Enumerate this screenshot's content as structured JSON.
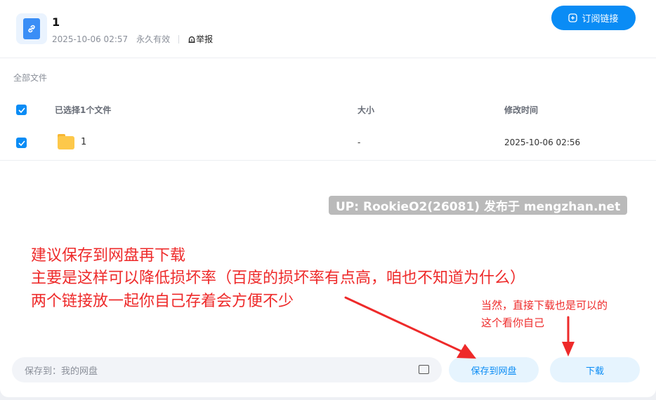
{
  "header": {
    "title": "1",
    "created": "2025-10-06 02:57",
    "validity": "永久有效",
    "report_label": "举报",
    "subscribe_label": "订阅链接"
  },
  "breadcrumb": "全部文件",
  "table": {
    "headers": [
      "已选择1个文件",
      "大小",
      "修改时间"
    ],
    "rows": [
      {
        "name": "1",
        "size": "-",
        "modified": "2025-10-06 02:56",
        "checked": true
      }
    ]
  },
  "watermark": "UP: RookieO2(26081) 发布于 mengzhan.net",
  "annotations": {
    "big": [
      "建议保存到网盘再下载",
      "主要是这样可以降低损坏率（百度的损坏率有点高，咱也不知道为什么）",
      "两个链接放一起你自己存着会方便不少"
    ],
    "small": [
      "当然，直接下载也是可以的",
      "这个看你自己"
    ]
  },
  "footer": {
    "save_path_label": "保存到：",
    "save_path_value": "我的网盘",
    "save_button": "保存到网盘",
    "download_button": "下载"
  },
  "colors": {
    "accent": "#0a8cf5",
    "annotation": "#ee2a2a"
  }
}
